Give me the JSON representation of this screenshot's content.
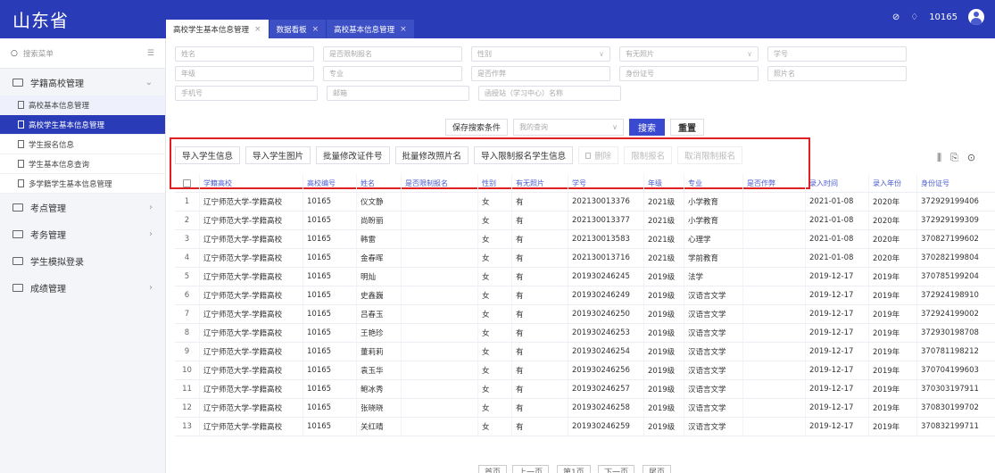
{
  "brand": {
    "title": "山东省"
  },
  "tabs": [
    {
      "label": "高校学生基本信息管理",
      "active": true
    },
    {
      "label": "数据看板",
      "active": false
    },
    {
      "label": "高校基本信息管理",
      "active": false
    }
  ],
  "user": {
    "id": "10165"
  },
  "sidebar": {
    "search_placeholder": "搜索菜单",
    "items": [
      {
        "label": "学籍高校管理",
        "expanded": true
      },
      {
        "label": "考点管理"
      },
      {
        "label": "考务管理"
      },
      {
        "label": "学生模拟登录"
      },
      {
        "label": "成绩管理"
      }
    ],
    "sub_items": [
      {
        "label": "高校基本信息管理"
      },
      {
        "label": "高校学生基本信息管理"
      },
      {
        "label": "学生报名信息"
      },
      {
        "label": "学生基本信息查询"
      },
      {
        "label": "多学籍学生基本信息管理"
      }
    ]
  },
  "filters": {
    "row1": [
      "姓名",
      "是否限制报名",
      "性别",
      "有无照片",
      "学号"
    ],
    "row2": [
      "年级",
      "专业",
      "是否作弊",
      "身份证号",
      "照片名"
    ],
    "row3": [
      "手机号",
      "邮箱",
      "函授站（学习中心）名称"
    ],
    "save_label": "保存搜索条件",
    "query_placeholder": "我的查询",
    "search_label": "搜索",
    "reset_label": "重置"
  },
  "toolbar": {
    "import_info": "导入学生信息",
    "import_photo": "导入学生图片",
    "batch_id": "批量修改证件号",
    "batch_photo": "批量修改照片名",
    "import_restrict": "导入限制报名学生信息",
    "delete": "删除",
    "restrict": "限制报名",
    "unrestrict": "取消限制报名"
  },
  "table": {
    "headers": [
      "学籍高校",
      "高校编号",
      "姓名",
      "是否限制报名",
      "性别",
      "有无照片",
      "学号",
      "年级",
      "专业",
      "是否作弊",
      "录入时间",
      "录入年份",
      "身份证号"
    ],
    "rows": [
      {
        "n": "1",
        "school": "辽宁师范大学-学籍高校",
        "code": "10165",
        "name": "仪文静",
        "restrict": "",
        "gender": "女",
        "photo": "有",
        "sid": "202130013376",
        "grade": "2021级",
        "major": "小学教育",
        "cheat": "",
        "time": "2021-01-08",
        "year": "2020年",
        "idno": "372929199406"
      },
      {
        "n": "2",
        "school": "辽宁师范大学-学籍高校",
        "code": "10165",
        "name": "尚盼丽",
        "restrict": "",
        "gender": "女",
        "photo": "有",
        "sid": "202130013377",
        "grade": "2021级",
        "major": "小学教育",
        "cheat": "",
        "time": "2021-01-08",
        "year": "2020年",
        "idno": "372929199309"
      },
      {
        "n": "3",
        "school": "辽宁师范大学-学籍高校",
        "code": "10165",
        "name": "韩雷",
        "restrict": "",
        "gender": "女",
        "photo": "有",
        "sid": "202130013583",
        "grade": "2021级",
        "major": "心理学",
        "cheat": "",
        "time": "2021-01-08",
        "year": "2020年",
        "idno": "370827199602"
      },
      {
        "n": "4",
        "school": "辽宁师范大学-学籍高校",
        "code": "10165",
        "name": "金春晖",
        "restrict": "",
        "gender": "女",
        "photo": "有",
        "sid": "202130013716",
        "grade": "2021级",
        "major": "学前教育",
        "cheat": "",
        "time": "2021-01-08",
        "year": "2020年",
        "idno": "370282199804"
      },
      {
        "n": "5",
        "school": "辽宁师范大学-学籍高校",
        "code": "10165",
        "name": "明灿",
        "restrict": "",
        "gender": "女",
        "photo": "有",
        "sid": "201930246245",
        "grade": "2019级",
        "major": "法学",
        "cheat": "",
        "time": "2019-12-17",
        "year": "2019年",
        "idno": "370785199204"
      },
      {
        "n": "6",
        "school": "辽宁师范大学-学籍高校",
        "code": "10165",
        "name": "史鑫巍",
        "restrict": "",
        "gender": "女",
        "photo": "有",
        "sid": "201930246249",
        "grade": "2019级",
        "major": "汉语言文学",
        "cheat": "",
        "time": "2019-12-17",
        "year": "2019年",
        "idno": "372924198910"
      },
      {
        "n": "7",
        "school": "辽宁师范大学-学籍高校",
        "code": "10165",
        "name": "吕春玉",
        "restrict": "",
        "gender": "女",
        "photo": "有",
        "sid": "201930246250",
        "grade": "2019级",
        "major": "汉语言文学",
        "cheat": "",
        "time": "2019-12-17",
        "year": "2019年",
        "idno": "372924199002"
      },
      {
        "n": "8",
        "school": "辽宁师范大学-学籍高校",
        "code": "10165",
        "name": "王艳珍",
        "restrict": "",
        "gender": "女",
        "photo": "有",
        "sid": "201930246253",
        "grade": "2019级",
        "major": "汉语言文学",
        "cheat": "",
        "time": "2019-12-17",
        "year": "2019年",
        "idno": "372930198708"
      },
      {
        "n": "9",
        "school": "辽宁师范大学-学籍高校",
        "code": "10165",
        "name": "董莉莉",
        "restrict": "",
        "gender": "女",
        "photo": "有",
        "sid": "201930246254",
        "grade": "2019级",
        "major": "汉语言文学",
        "cheat": "",
        "time": "2019-12-17",
        "year": "2019年",
        "idno": "370781198212"
      },
      {
        "n": "10",
        "school": "辽宁师范大学-学籍高校",
        "code": "10165",
        "name": "袁玉华",
        "restrict": "",
        "gender": "女",
        "photo": "有",
        "sid": "201930246256",
        "grade": "2019级",
        "major": "汉语言文学",
        "cheat": "",
        "time": "2019-12-17",
        "year": "2019年",
        "idno": "370704199603"
      },
      {
        "n": "11",
        "school": "辽宁师范大学-学籍高校",
        "code": "10165",
        "name": "鲍冰秀",
        "restrict": "",
        "gender": "女",
        "photo": "有",
        "sid": "201930246257",
        "grade": "2019级",
        "major": "汉语言文学",
        "cheat": "",
        "time": "2019-12-17",
        "year": "2019年",
        "idno": "370303197911"
      },
      {
        "n": "12",
        "school": "辽宁师范大学-学籍高校",
        "code": "10165",
        "name": "张晓晓",
        "restrict": "",
        "gender": "女",
        "photo": "有",
        "sid": "201930246258",
        "grade": "2019级",
        "major": "汉语言文学",
        "cheat": "",
        "time": "2019-12-17",
        "year": "2019年",
        "idno": "370830199702"
      },
      {
        "n": "13",
        "school": "辽宁师范大学-学籍高校",
        "code": "10165",
        "name": "关红晴",
        "restrict": "",
        "gender": "女",
        "photo": "有",
        "sid": "201930246259",
        "grade": "2019级",
        "major": "汉语言文学",
        "cheat": "",
        "time": "2019-12-17",
        "year": "2019年",
        "idno": "370832199711"
      }
    ]
  },
  "pager": {
    "first": "首页",
    "prev": "上一页",
    "page": "第1页",
    "next": "下一页",
    "last": "尾页"
  },
  "colors": {
    "primary": "#2a3bb8",
    "highlight_box": "#e02020"
  }
}
